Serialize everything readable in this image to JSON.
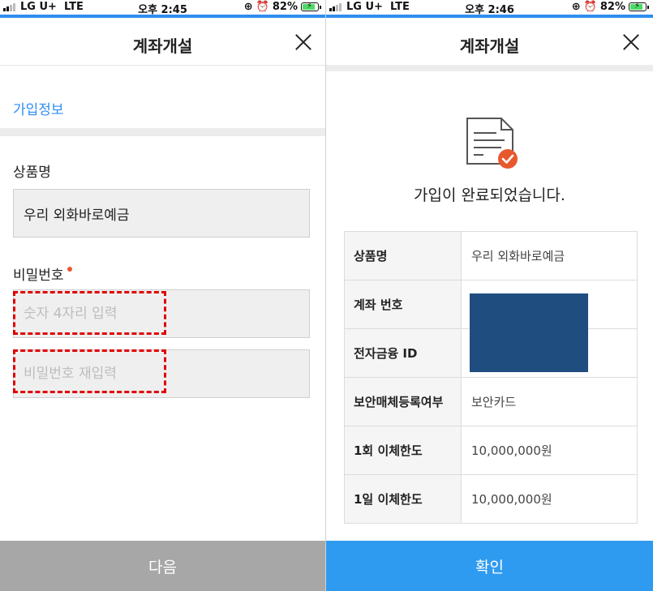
{
  "left": {
    "status": {
      "carrier": "LG U+",
      "network": "LTE",
      "time": "오후 2:45",
      "battery": "82%"
    },
    "header": {
      "title": "계좌개설"
    },
    "section_title": "가입정보",
    "product": {
      "label": "상품명",
      "value": "우리 외화바로예금"
    },
    "password": {
      "label": "비밀번호",
      "placeholder": "숫자 4자리 입력",
      "confirm_placeholder": "비밀번호 재입력"
    },
    "next_button": "다음"
  },
  "right": {
    "status": {
      "carrier": "LG U+",
      "network": "LTE",
      "time": "오후 2:46",
      "battery": "82%"
    },
    "header": {
      "title": "계좌개설"
    },
    "complete_message": "가입이 완료되었습니다.",
    "rows": [
      {
        "key": "상품명",
        "value": "우리 외화바로예금"
      },
      {
        "key": "계좌 번호",
        "value": ""
      },
      {
        "key": "전자금융 ID",
        "value": ""
      },
      {
        "key": "보안매체등록여부",
        "value": "보안카드"
      },
      {
        "key": "1회 이체한도",
        "value": "10,000,000원"
      },
      {
        "key": "1일 이체한도",
        "value": "10,000,000원"
      }
    ],
    "confirm_button": "확인"
  },
  "colors": {
    "accent": "#2f8ef0",
    "required": "#e8582d",
    "highlight": "#e00000",
    "redaction": "#204d80",
    "disabled": "#a7a7a7"
  },
  "icons": [
    "signal-icon",
    "alarm-icon",
    "lock-rotation-icon",
    "battery-icon",
    "close-icon",
    "document-check-icon"
  ]
}
